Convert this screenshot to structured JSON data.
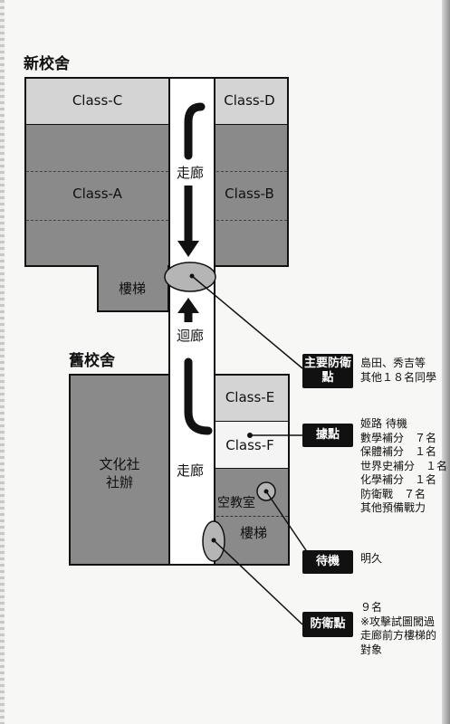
{
  "buildings": {
    "new": {
      "title": "新校舍",
      "rooms": {
        "class_c": "Class-C",
        "class_d": "Class-D",
        "class_a": "Class-A",
        "class_b": "Class-B",
        "stairs": "樓梯",
        "corridor": "走廊"
      }
    },
    "connector": {
      "label": "迴廊"
    },
    "old": {
      "title": "舊校舍",
      "rooms": {
        "culture_club": "文化社\n社辦",
        "class_e": "Class-E",
        "class_f": "Class-F",
        "empty_room": "空教室",
        "stairs": "樓梯",
        "corridor": "走廊"
      }
    }
  },
  "callouts": {
    "main_defense": {
      "label": "主要防衛\n點",
      "text": "島田、秀吉等\n其他１８名同學"
    },
    "base": {
      "label": "據點",
      "text": "姬路 待機\n數學補分　７名\n保體補分　１名\n世界史補分　１名\n化學補分　１名\n防衛戰　７名\n其他預備戰力"
    },
    "standby": {
      "label": "待機",
      "text": "明久"
    },
    "defense": {
      "label": "防衛點",
      "text": "９名\n※攻擊試圖闖過\n走廊前方樓梯的\n對象"
    }
  },
  "colors": {
    "dark_room": "#8a8a8a",
    "mid_room": "#a9a9a9",
    "light_room": "#d4d4d4",
    "white_room": "#f4f4f4",
    "corridor": "#ffffff",
    "ink": "#111111"
  }
}
